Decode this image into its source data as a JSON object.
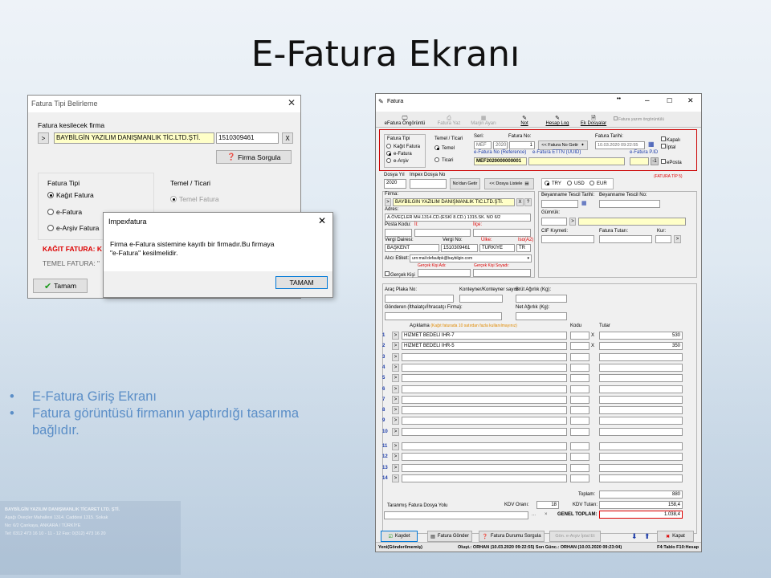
{
  "slide": {
    "title": "E-Fatura Ekranı",
    "bullets": [
      "E-Fatura Giriş Ekranı",
      "Fatura görüntüsü firmanın yaptırdığı tasarıma bağlıdır."
    ]
  },
  "bg_company": [
    "BAYBİLGİN YAZILIM DANIŞMANLIK TİCARET LTD. ŞTİ.",
    "Aşağı Öveçler Mahallesi 1314. Caddesi 1315. Sokak",
    "No: 6/2 Çankaya, ANKARA / TÜRKİYE",
    "Tel: 0312 473 16 10 - 11 - 12 Fax: 0(312) 473 16 20"
  ],
  "dialog_tipi": {
    "title": "Fatura Tipi Belirleme",
    "firm_label": "Fatura kesilecek firma",
    "firm_name": "BAYBİLGİN YAZILIM DANIŞMANLIK TİC.LTD.ŞTİ.",
    "tax_no": "1510309461",
    "query_btn": "Firma Sorgula",
    "type_label": "Fatura Tipi",
    "types": [
      "Kağıt Fatura",
      "e-Fatura",
      "e-Arşiv Fatura"
    ],
    "selected_type": 0,
    "temel_label": "Temel / Ticari",
    "temel_option": "Temel Fatura",
    "warn_red": "KAĞIT FATURA: K",
    "warn_grey": "TEMEL FATURA: \"",
    "ok_btn": "Tamam",
    "arrow": ">",
    "x_btn": "X"
  },
  "dialog_msg": {
    "title": "Impexfatura",
    "message_line1": "Firma e-Fatura sistemine kayıtlı bir firmadır.Bu firmaya",
    "message_line2": "\"e-Fatura\" kesilmelidir.",
    "ok": "TAMAM"
  },
  "win": {
    "title": "Fatura",
    "toolbar": [
      "eFatura Öngörüntü",
      "Fatura Yaz",
      "Marjin Ayarı",
      "Not",
      "Hesap Log",
      "Ek Dosyalar"
    ],
    "print_preview": "Fatura yazım öngörüntülü",
    "tipi_label": "Fatura Tipi",
    "tipi_options": [
      "Kağıt Fatura",
      "e-Fatura",
      "e-Arşiv"
    ],
    "tipi_selected": 1,
    "temel_label": "Temel / Ticari",
    "temel_options": [
      "Temel",
      "Ticari"
    ],
    "seri_label": "Seri:",
    "no_label": "Fatura No:",
    "seri": "MEF",
    "year": "2020",
    "num": "1",
    "no_getir": "<< Fatura No Getir",
    "tarih_label": "Fatura Tarihi:",
    "tarih": "10.03.2020 09:22:55",
    "kapali": "Kapalı",
    "iptal": "İptal",
    "eposta": "ePosta",
    "ref_label": "e-Fatura No (Reference)",
    "ettn_label": "e-Fatura ETTN (UUID)",
    "pid_label": "e-Fatura P.ID",
    "ref_no": "MEF2020000000001",
    "pid_val": "-1",
    "dosya_yil_label": "Dosya Yıl",
    "impex_dosya_label": "Impex Dosya No",
    "dosya_yil": "2020",
    "nodan_getir": "No'dan Getir",
    "dosya_listele": "<< Dosya Listele",
    "currencies": [
      "TRY",
      "USD",
      "EUR"
    ],
    "fatura_tip": "(FATURA TİP 5)",
    "firma_label": "Firma:",
    "firma": "BAYBİLGİN YAZILIM DANIŞMANLIK TİC.LTD.ŞTİ.",
    "adres_label": "Adres:",
    "adres": "A.ÖVEÇLER MH.1314.CD.(ESKİ 8.CD.) 1315.SK. NO 6/2",
    "posta_label": "Posta Kodu:",
    "il_label": "İl:",
    "ilce_label": "İlçe:",
    "vd_label": "Vergi Dairesi:",
    "vno_label": "Vergi No:",
    "ulke_label": "Ülke:",
    "iso_label": "Iso(A2)",
    "vd": "BAŞKENT",
    "vno": "1510309461",
    "ulke": "TÜRKİYE",
    "iso": "TR",
    "alici_label": "Alıcı Etiket:",
    "alici": "urn:mail:defaultpk@baybilgin.com",
    "gercek_adi": "Gerçek Kişi Adı:",
    "gercek_soyadi": "Gerçek Kişi Soyadı:",
    "gercek_kisi": "Gerçek Kişi",
    "beyan_tarih": "Beyanname Tescil Tarihi:",
    "beyan_no": "Beyanname Tescil No:",
    "gumruk": "Gümrük:",
    "cif": "CIF Kıymeti:",
    "fat_tutar": "Fatura Tutarı:",
    "kur": "Kur:",
    "plaka": "Araç Plaka No:",
    "konteyner": "Konteyner/Konteyner sayısı:",
    "brut": "Brüt Ağırlık (Kg):",
    "gonderen": "Gönderen (İthalatçı/İhracatçı Firma):",
    "net": "Net Ağırlık (Kg):",
    "aciklama": "Açıklama",
    "aciklama_note": "(Kağıt faturada 10 satırdan fazla kullanılmayınız)",
    "kodu": "Kodu",
    "tutar": "Tutar",
    "lines": [
      {
        "n": "1",
        "desc": "HİZMET BEDELİ İHR-7",
        "tutar": "530"
      },
      {
        "n": "2",
        "desc": "HİZMET BEDELİ İHR-5",
        "tutar": "350"
      },
      {
        "n": "3",
        "desc": "",
        "tutar": ""
      },
      {
        "n": "4",
        "desc": "",
        "tutar": ""
      },
      {
        "n": "5",
        "desc": "",
        "tutar": ""
      },
      {
        "n": "6",
        "desc": "",
        "tutar": ""
      },
      {
        "n": "7",
        "desc": "",
        "tutar": ""
      },
      {
        "n": "8",
        "desc": "",
        "tutar": ""
      },
      {
        "n": "9",
        "desc": "",
        "tutar": ""
      },
      {
        "n": "10",
        "desc": "",
        "tutar": ""
      }
    ],
    "lines2": [
      "11",
      "12",
      "13",
      "14"
    ],
    "toplam_label": "Toplam:",
    "toplam": "880",
    "taranmis": "Taranmış Fatura Dosya Yolu",
    "kdv_orani_label": "KDV Oranı:",
    "kdv_orani": "18",
    "kdv_tutari_label": "KDV Tutarı:",
    "kdv_tutari": "158,4",
    "genel_label": "GENEL TOPLAM:",
    "genel": "1.038,4",
    "dots": "...",
    "bottom_buttons": [
      "Kaydet",
      "Fatura Gönder",
      "Fatura Durumu Sorgula",
      "Gön. e-Arşiv İptal Et",
      "Kapat"
    ],
    "status": [
      "Yeni(Gönderilmemiş)",
      "Oluşt.: ORHAN (10.03.2020 09:22:55) Son Günc.: ORHAN (10.03.2020 09:23:04)",
      "F4:Tablo F10:Hesap"
    ]
  }
}
